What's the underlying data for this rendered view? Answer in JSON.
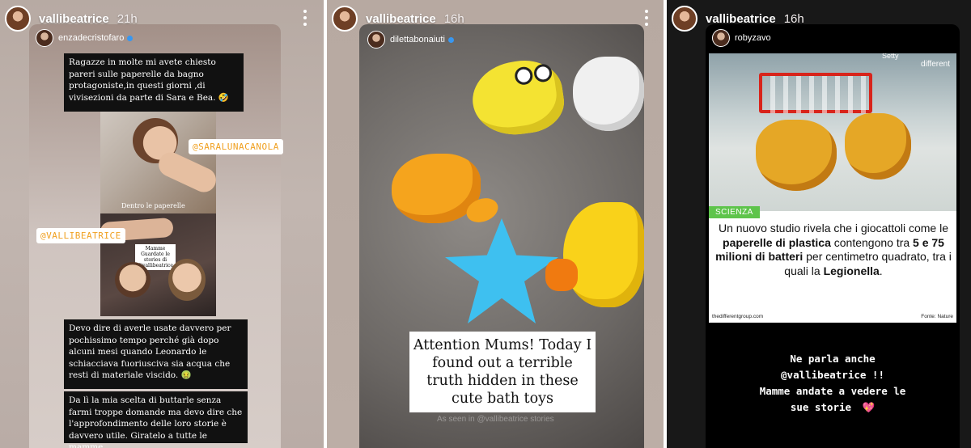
{
  "stories": [
    {
      "username": "vallibeatrice",
      "time": "21h",
      "repost": {
        "username": "enzadecristofaro",
        "text_top": "Ragazze in molte mi avete chiesto pareri sulle paperelle da bagno protagoniste,in questi giorni ,di vivisezioni da parte di Sara e Bea. 🤣",
        "photo_caption": "Dentro le paperelle",
        "tag_1": "@SARALUNACANOLA",
        "tag_2": "@VALLIBEATRICE",
        "note_text": "Mamme Guardate le stories di @vallibeatrice",
        "text_middle": "Devo dire di averle usate davvero per pochissimo tempo perché già dopo alcuni mesi quando Leonardo le schiacciava fuoriusciva sia acqua che resti di materiale viscido. 🤢",
        "text_bottom": "Da lì la mia scelta di buttarle senza farmi troppe domande ma devo dire che l'approfondimento delle loro storie è davvero utile. Giratelo a tutte le mamme."
      }
    },
    {
      "username": "vallibeatrice",
      "time": "16h",
      "repost": {
        "username": "dilettabonaiuti",
        "caption": "Attention Mums! Today I found out a terrible truth hidden in these cute bath toys",
        "faint_text": "As seen in @vallibeatrice stories"
      }
    },
    {
      "username": "vallibeatrice",
      "time": "16h",
      "repost": {
        "username": "robyzavo",
        "lab_brand": "different",
        "lab_top": "Setty",
        "badge": "SCIENZA",
        "headline_pre": "Un nuovo studio rivela che i giocattoli come le ",
        "headline_b1": "paperelle di plastica",
        "headline_mid": " contengono tra ",
        "headline_b2": "5 e 75 milioni di batteri",
        "headline_mid2": " per centimetro quadrato, tra i quali la ",
        "headline_b3": "Legionella",
        "headline_end": ".",
        "source_left": "thedifferentgroup.com",
        "source_right": "Fonte: Nature",
        "line1": "Ne parla anche",
        "line2": "@vallibeatrice !!",
        "line3": "Mamme andate a vedere le",
        "line4": "sue storie",
        "heart": "💖"
      }
    }
  ],
  "icons": {
    "more": "more-options-icon",
    "verified": "verified-badge-icon"
  },
  "colors": {
    "tag_text": "#f0a020",
    "badge_green": "#5ec44b",
    "verified_blue": "#3897f0",
    "rack_red": "#d8241b"
  }
}
